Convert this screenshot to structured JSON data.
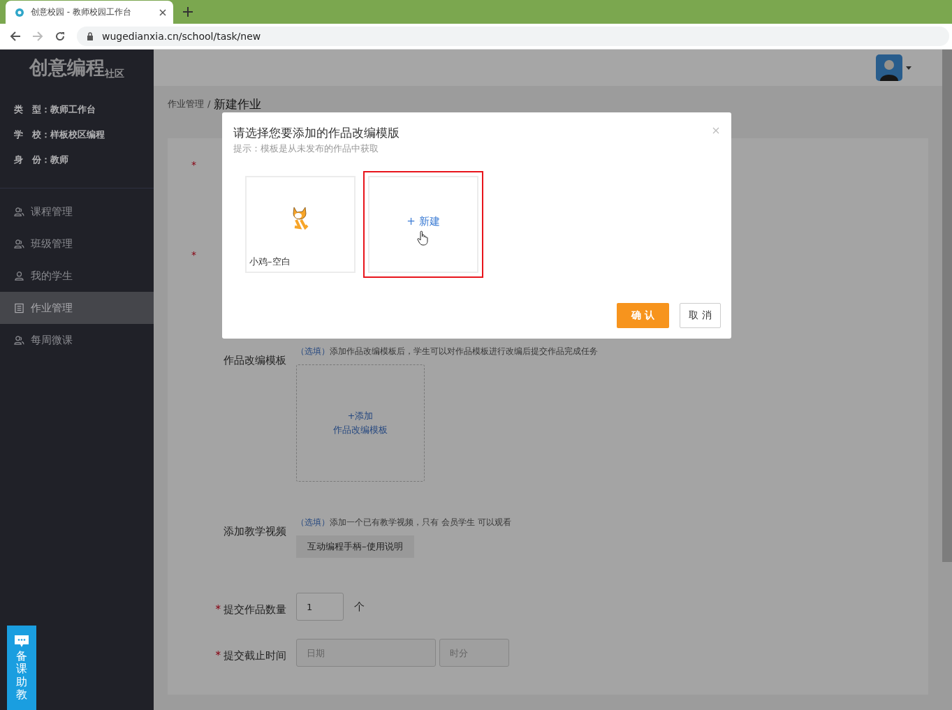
{
  "browser": {
    "tab_title": "创意校园 - 教师校园工作台",
    "url": "wugedianxia.cn/school/task/new"
  },
  "sidebar": {
    "logo": "创意编程",
    "logo_suffix": "社区",
    "info": [
      "类　型：教师工作台",
      "学　校：样板校区编程",
      "身　份：教师"
    ],
    "menu": [
      {
        "label": "课程管理",
        "selected": false
      },
      {
        "label": "班级管理",
        "selected": false
      },
      {
        "label": "我的学生",
        "selected": false
      },
      {
        "label": "作业管理",
        "selected": true
      },
      {
        "label": "每周微课",
        "selected": false
      }
    ]
  },
  "breadcrumb": {
    "items": [
      "作业管理",
      "新建作业"
    ],
    "separator": "/"
  },
  "form": {
    "hidden_required_marks": [
      "*",
      "*"
    ],
    "template": {
      "label": "作品改编模板",
      "optional": "（选填）",
      "hint": "添加作品改编模板后，学生可以对作品模板进行改编后提交作品完成任务",
      "add_line1": "+添加",
      "add_line2": "作品改编模板"
    },
    "video": {
      "label": "添加教学视频",
      "optional": "（选填）",
      "hint": "添加一个已有教学视频，只有 会员学生 可以观看",
      "chip": "互动编程手柄–使用说明"
    },
    "count": {
      "mark": "*",
      "label": "提交作品数量",
      "value": "1",
      "unit": "个"
    },
    "deadline": {
      "mark": "*",
      "label": "提交截止时间",
      "date_placeholder": "日期",
      "time_placeholder": "时分"
    }
  },
  "modal": {
    "title": "请选择您要添加的作品改编模版",
    "hint": "提示：模板是从未发布的作品中获取",
    "templates": [
      {
        "kind": "project",
        "name": "小鸡–空白",
        "selected": false
      },
      {
        "kind": "new",
        "name": "+ 新建",
        "selected": true
      }
    ],
    "confirm": "确 认",
    "cancel": "取 消"
  },
  "helper": {
    "label": "备课助教"
  }
}
